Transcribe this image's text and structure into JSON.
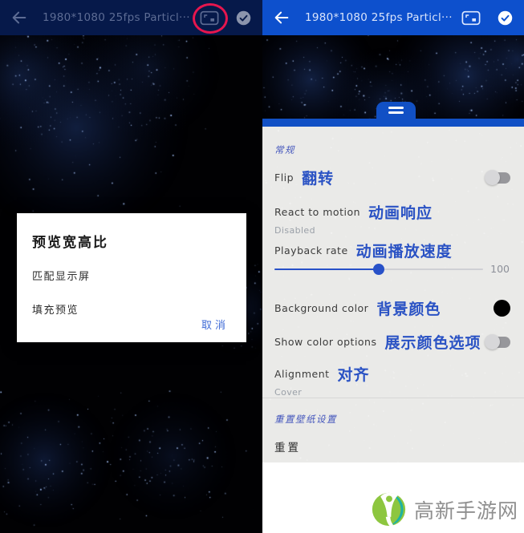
{
  "left": {
    "appbar": {
      "title": "1980*1080 25fps Particl···"
    },
    "dialog": {
      "title": "预览宽高比",
      "options": [
        "匹配显示屏",
        "填充预览"
      ],
      "cancel_label": "取消"
    }
  },
  "right": {
    "appbar": {
      "title": "1980*1080 25fps Particl···"
    },
    "panel": {
      "sections": {
        "general": "常规",
        "reset": "重置壁纸设置"
      },
      "flip": {
        "en": "Flip",
        "zh": "翻转",
        "state": "off"
      },
      "react_to_motion": {
        "en": "React to motion",
        "zh": "动画响应",
        "value": "Disabled"
      },
      "playback_rate": {
        "en": "Playback rate",
        "zh": "动画播放速度",
        "value": "100",
        "percent": 50
      },
      "background_color": {
        "en": "Background color",
        "zh": "背景颜色",
        "swatch": "#000000"
      },
      "show_color_options": {
        "en": "Show color options",
        "zh": "展示颜色选项",
        "state": "off"
      },
      "alignment": {
        "en": "Alignment",
        "zh": "对齐",
        "value": "Cover"
      },
      "reset_label": "重置"
    }
  },
  "watermark": {
    "text": "高新手游网",
    "green": "#8dc63f",
    "teal": "#1db3a3"
  },
  "icons": {
    "appbar": [
      "back-icon",
      "aspect-ratio-icon",
      "confirm-icon"
    ],
    "panel": [
      "menu-handle-icon"
    ],
    "highlight": "red-ellipse-annotation"
  },
  "colors": {
    "left_bar": "#06194a",
    "right_bar": "#0d50cd",
    "sheet_blue": "#1150c5",
    "accent_blue": "#2a52c4",
    "panel_bg": "#eaeae8",
    "highlight_ring": "#e6164e"
  }
}
